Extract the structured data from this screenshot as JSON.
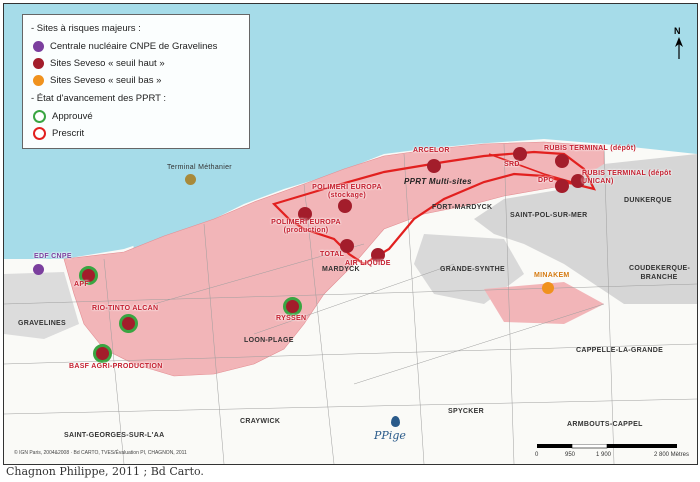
{
  "legend": {
    "major_sites_title": "- Sites à risques majeurs :",
    "items": [
      {
        "label": "Centrale nucléaire CNPE de Gravelines",
        "color": "#7b3f9e"
      },
      {
        "label": "Sites Seveso « seuil haut »",
        "color": "#a31d2b"
      },
      {
        "label": "Sites Seveso « seuil bas »",
        "color": "#f0921e"
      }
    ],
    "pprt_title": "- État d'avancement des PPRT :",
    "pprt_items": [
      {
        "label": "Approuvé",
        "color": "#3aa542"
      },
      {
        "label": "Prescrit",
        "color": "#e2201f"
      }
    ]
  },
  "sites": {
    "arcelor": "ARCELOR",
    "srd": "SRD",
    "rubis_depot": "RUBIS TERMINAL (dépôt)",
    "rubis_unican": "RUBIS TERMINAL (dépôt UNICAN)",
    "dpc": "DPC",
    "polimeri_stockage": "POLIMERI EUROPA (stockage)",
    "polimeri_production": "POLIMERI EUROPA (production)",
    "total": "TOTAL",
    "air_liquide": "AIR LIQUIDE",
    "pprt_multi": "PPRT Multi-sites",
    "edf": "EDF CNPE",
    "apf": "APF",
    "rio_tinto": "RIO-TINTO ALCAN",
    "ryssen": "RYSSEN",
    "basf": "BASF AGRI-PRODUCTION",
    "minakem": "MINAKEM",
    "terminal": "Terminal Méthanier"
  },
  "towns": {
    "dunkerque": "DUNKERQUE",
    "fort_mardyck": "FORT-MARDYCK",
    "saint_pol": "SAINT-POL-SUR-MER",
    "mardyck": "MARDYCK",
    "grande_synthe": "GRANDE-SYNTHE",
    "coudekerque": "COUDEKERQUE-BRANCHE",
    "gravelines": "GRAVELINES",
    "loon_plage": "LOON-PLAGE",
    "cappelle": "CAPPELLE-LA-GRANDE",
    "craywick": "CRAYWICK",
    "spycker": "SPYCKER",
    "armbouts": "ARMBOUTS-CAPPEL",
    "saint_georges": "SAINT-GEORGES-SUR-L'AA"
  },
  "north": "N",
  "scale": {
    "zero": "0",
    "mid1": "950",
    "mid2": "1 900",
    "end": "2 800 Mètres"
  },
  "logo": {
    "text": "PPige"
  },
  "credits": "© IGN Paris, 2004&2008 · Bd CARTO, TVES/Évaluation PI, CHAGNON, 2011",
  "caption": "Chagnon Philippe, 2011 ; Bd Carto.",
  "colors": {
    "sea": "#a6dce9",
    "zone": "#f2b5b8",
    "urban": "#d6d6d6"
  }
}
